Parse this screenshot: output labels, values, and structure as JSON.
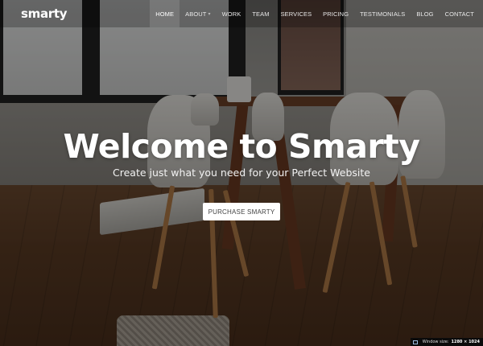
{
  "brand": {
    "logo": "smarty"
  },
  "nav": {
    "items": [
      {
        "label": "HOME",
        "active": true
      },
      {
        "label": "ABOUT",
        "dropdown": true
      },
      {
        "label": "WORK"
      },
      {
        "label": "TEAM"
      },
      {
        "label": "SERVICES"
      },
      {
        "label": "PRICING"
      },
      {
        "label": "TESTIMONIALS"
      },
      {
        "label": "BLOG"
      },
      {
        "label": "CONTACT"
      }
    ]
  },
  "hero": {
    "title": "Welcome to Smarty",
    "subtitle": "Create just what you need for your Perfect Website",
    "cta_label": "PURCHASE SMARTY"
  },
  "window_size": {
    "label": "Window size:",
    "value": "1280 × 1024"
  },
  "icons": {
    "dropdown": "chevron-down-icon",
    "window": "window-icon"
  }
}
